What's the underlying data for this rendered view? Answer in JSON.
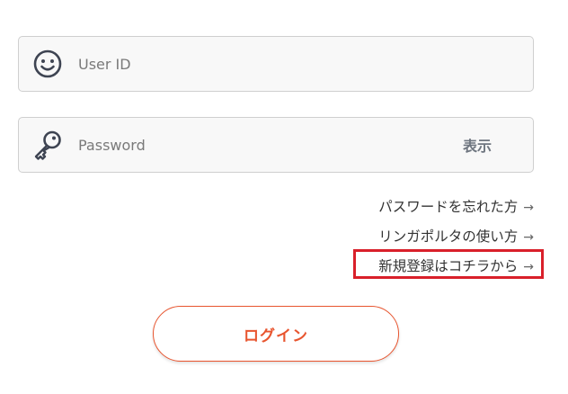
{
  "form": {
    "user_id": {
      "placeholder": "User ID",
      "value": "",
      "icon": "smiley-face-icon"
    },
    "password": {
      "placeholder": "Password",
      "value": "",
      "icon": "key-icon",
      "show_label": "表示"
    }
  },
  "links": {
    "forgot_password": "パスワードを忘れた方",
    "how_to_use": "リンガポルタの使い方",
    "register": "新規登録はコチラから",
    "arrow": "→"
  },
  "login_button": {
    "label": "ログイン"
  },
  "colors": {
    "accent": "#e8552f",
    "highlight_box": "#d9202a",
    "field_border": "#cfcfcf",
    "field_background": "#f8f8f8"
  }
}
